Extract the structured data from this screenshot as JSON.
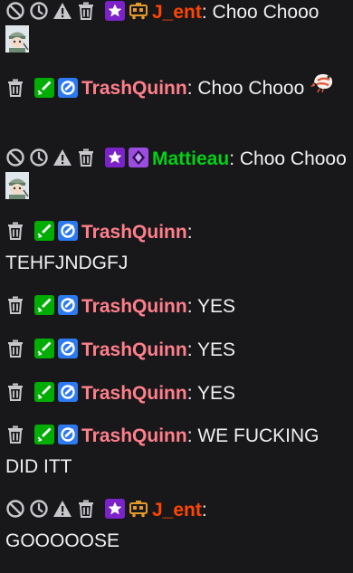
{
  "colors": {
    "background": "#18181b",
    "text": "#efeff1",
    "mod_icon": "#c8c8cc",
    "user_jent": "#ff4500",
    "user_trashquinn": "#ff7f8a",
    "user_mattieau": "#00d116",
    "badge_sub": "#7b22c8",
    "badge_mod": "#00ad03",
    "badge_verified": "#2d79f0"
  },
  "messages": [
    {
      "user": "J_ent",
      "separator": ": ",
      "text": "Choo Chooo",
      "emote": "choo-train-emote"
    },
    {
      "user": "TrashQuinn",
      "separator": ": ",
      "text": "Choo Chooo",
      "emote": "shrimp-emote"
    },
    {
      "user": "Mattieau",
      "separator": ": ",
      "text": "Choo Chooo",
      "emote": "choo-train-emote"
    },
    {
      "user": "TrashQuinn",
      "separator": ":",
      "text": "TEHFJNDGFJ"
    },
    {
      "user": "TrashQuinn",
      "separator": ": ",
      "text": "YES"
    },
    {
      "user": "TrashQuinn",
      "separator": ": ",
      "text": "YES"
    },
    {
      "user": "TrashQuinn",
      "separator": ": ",
      "text": "YES"
    },
    {
      "user": "TrashQuinn",
      "separator": ": ",
      "text": "WE FUCKING DID ITT"
    },
    {
      "user": "J_ent",
      "separator": ":",
      "text": "GOOOOOSE"
    }
  ],
  "icons": {
    "ban": "ban-icon",
    "timeout": "timeout-icon",
    "warn": "warning-icon",
    "delete": "delete-icon",
    "sub_badge": "star-subscriber-badge",
    "train_badge": "train-badge",
    "mod_badge": "sword-moderator-badge",
    "verified_badge": "verified-badge",
    "gem_badge": "diamond-badge"
  }
}
